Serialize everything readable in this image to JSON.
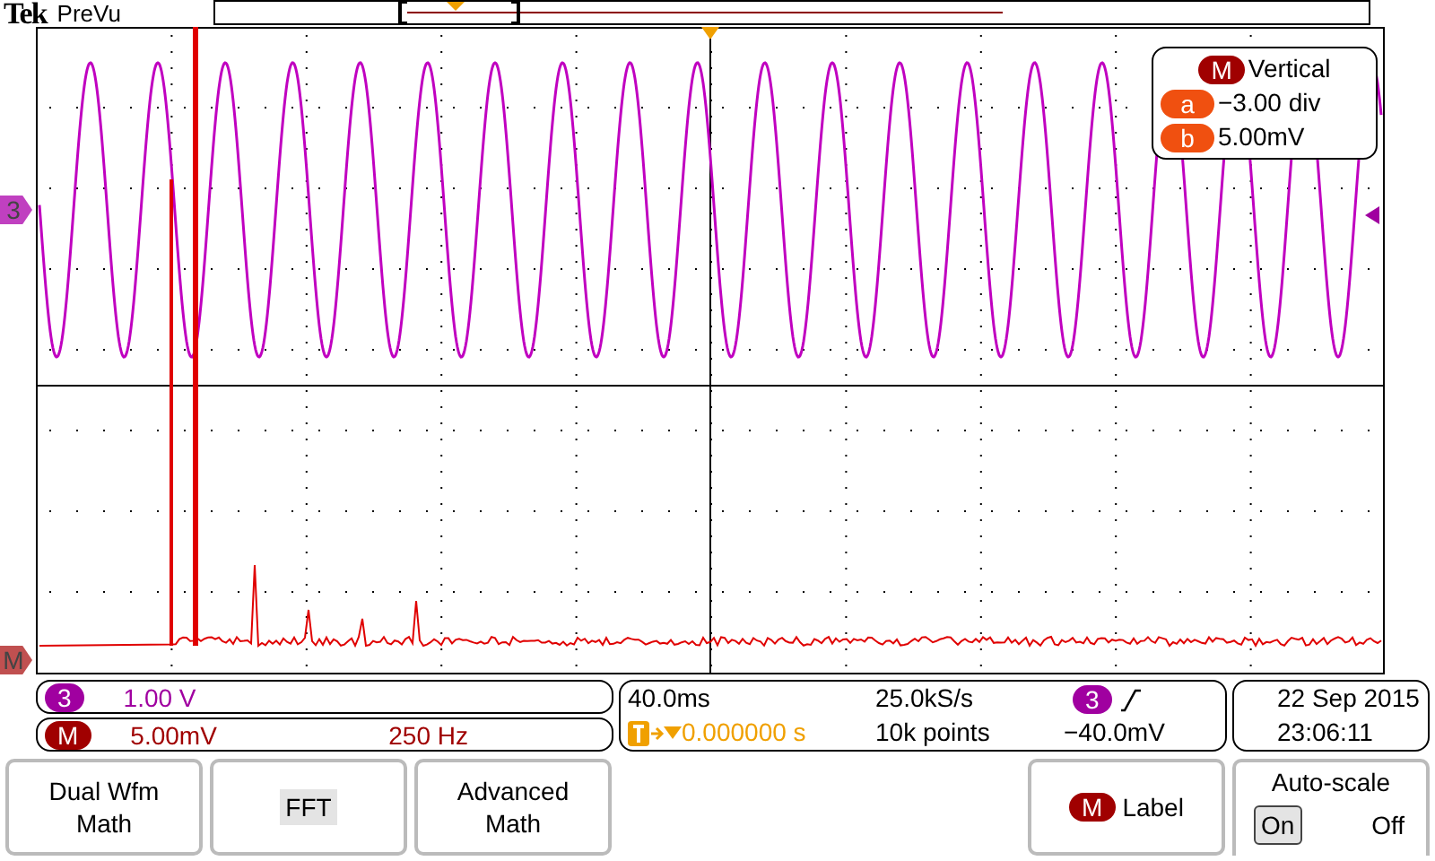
{
  "header": {
    "brand": "Tek",
    "status": "PreVu"
  },
  "markers": [
    {
      "label": "3",
      "color": "#c040c0"
    },
    {
      "label": "M",
      "color": "#c05050"
    }
  ],
  "vertical_readout": {
    "badge": "M",
    "title": "Vertical",
    "rows": [
      {
        "badge": "a",
        "value": "−3.00 div"
      },
      {
        "badge": "b",
        "value": "5.00mV"
      }
    ]
  },
  "channels": [
    {
      "badge": "3",
      "scale": "1.00 V",
      "color": "#a000a0"
    },
    {
      "badge": "M",
      "scale": "5.00mV",
      "frequency": "250 Hz",
      "color": "#a00000"
    }
  ],
  "acquisition": {
    "time_scale": "40.0ms",
    "trigger_position": "0.000000 s",
    "sample_rate": "25.0kS/s",
    "record_length": "10k points",
    "trigger_source": "3",
    "trigger_level": "−40.0mV"
  },
  "datetime": {
    "date": "22 Sep 2015",
    "time": "23:06:11"
  },
  "menu": [
    {
      "label": "Dual Wfm Math",
      "selected": false
    },
    {
      "label": "FFT",
      "selected": true
    },
    {
      "label": "Advanced Math",
      "selected": false
    }
  ],
  "label_button": {
    "badge": "M",
    "label": "Label"
  },
  "autoscale": {
    "title": "Auto-scale",
    "options": [
      {
        "label": "On",
        "selected": true
      },
      {
        "label": "Off",
        "selected": false
      }
    ]
  }
}
